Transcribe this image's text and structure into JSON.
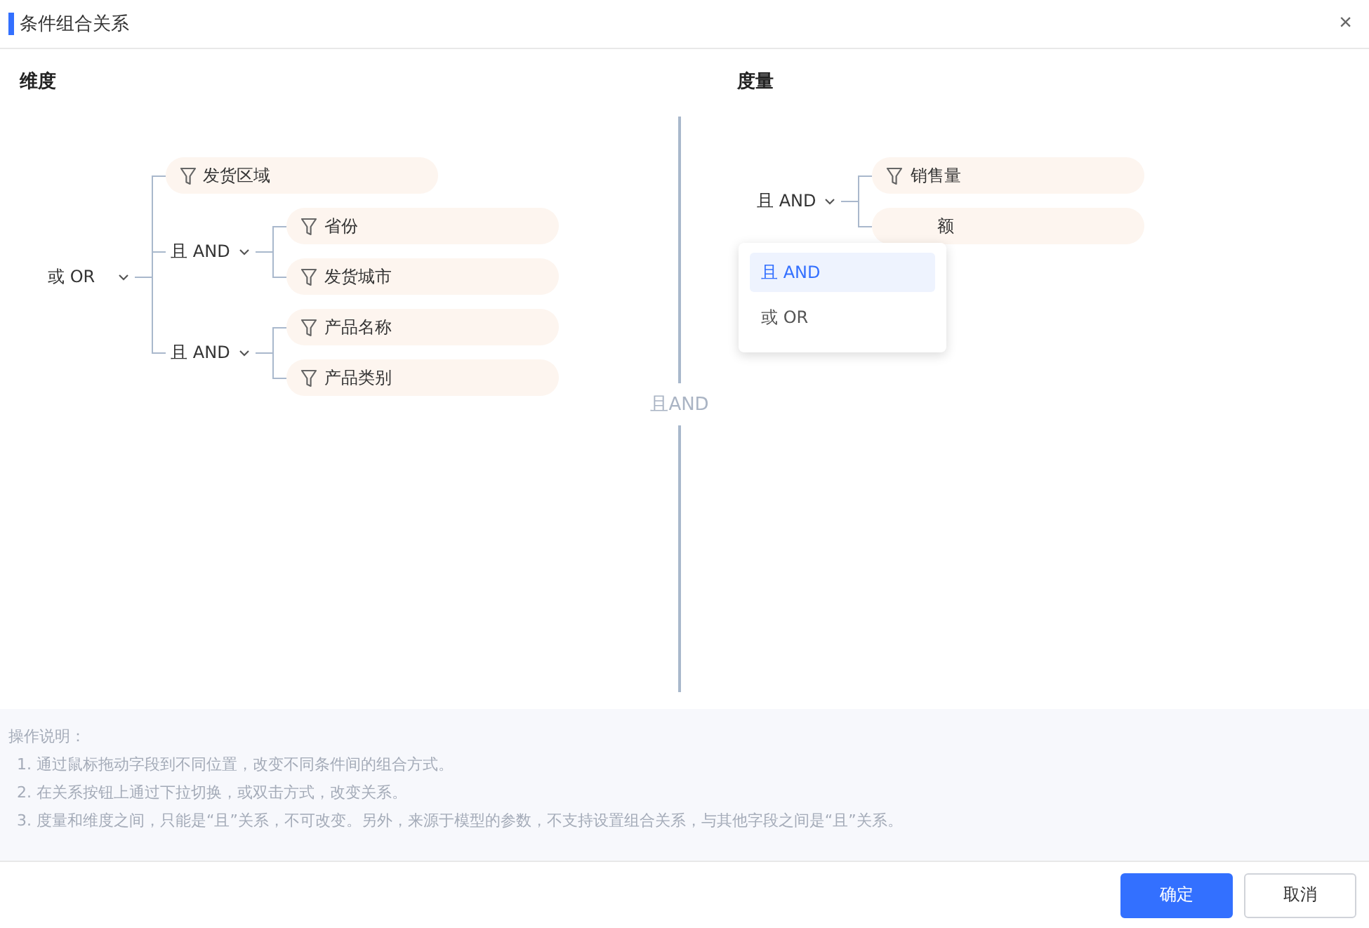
{
  "window": {
    "title": "条件组合关系",
    "close": "×"
  },
  "dimension": {
    "title": "维度",
    "tree": {
      "kind": "group",
      "relation": "或 OR",
      "children": [
        {
          "kind": "field",
          "label": "发货区域"
        },
        {
          "kind": "group",
          "relation": "且 AND",
          "children": [
            {
              "kind": "field",
              "label": "省份"
            },
            {
              "kind": "field",
              "label": "发货城市"
            }
          ]
        },
        {
          "kind": "group",
          "relation": "且 AND",
          "children": [
            {
              "kind": "field",
              "label": "产品名称"
            },
            {
              "kind": "field",
              "label": "产品类别"
            }
          ]
        }
      ]
    }
  },
  "between": "且AND",
  "measure": {
    "title": "度量",
    "tree": {
      "kind": "group",
      "relation": "且 AND",
      "children": [
        {
          "kind": "field",
          "label": "销售量"
        },
        {
          "kind": "covered-field",
          "label": "额"
        }
      ]
    },
    "dropdown": [
      {
        "label": "且 AND",
        "selected": true
      },
      {
        "label": "或 OR",
        "selected": false
      }
    ]
  },
  "notes": {
    "title": "操作说明：",
    "items": [
      "1. 通过鼠标拖动字段到不同位置，改变不同条件间的组合方式。",
      "2. 在关系按钮上通过下拉切换，或双击方式，改变关系。",
      "3. 度量和维度之间，只能是“且”关系，不可改变。另外，来源于模型的参数，不支持设置组合关系，与其他字段之间是“且”关系。"
    ]
  },
  "buttons": [
    {
      "label": "确定",
      "primary": true
    },
    {
      "label": "取消",
      "primary": false
    }
  ]
}
